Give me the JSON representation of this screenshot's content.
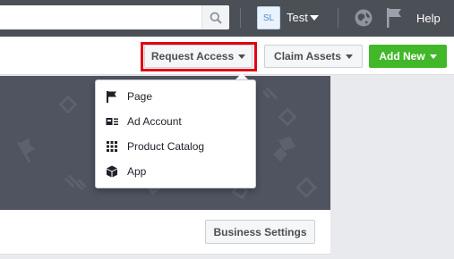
{
  "topbar": {
    "account_initials": "SL",
    "account_name": "Test",
    "help_label": "Help"
  },
  "toolbar": {
    "request_access_label": "Request Access",
    "claim_assets_label": "Claim Assets",
    "add_new_label": "Add New"
  },
  "dropdown": {
    "items": [
      {
        "label": "Page",
        "icon": "flag-icon"
      },
      {
        "label": "Ad Account",
        "icon": "ad-account-icon"
      },
      {
        "label": "Product Catalog",
        "icon": "grid-icon"
      },
      {
        "label": "App",
        "icon": "cube-icon"
      }
    ]
  },
  "card": {
    "business_settings_label": "Business Settings"
  },
  "colors": {
    "topbar_bg": "#4b4f56",
    "accent_green": "#42b72a",
    "highlight_red": "#e00015"
  }
}
